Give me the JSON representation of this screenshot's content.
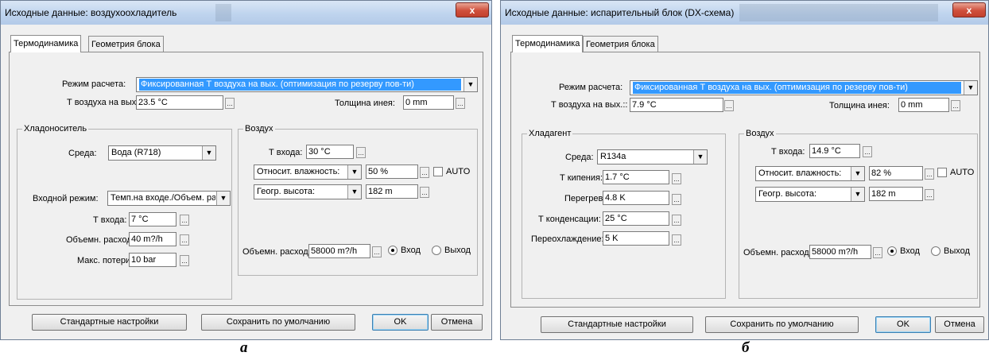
{
  "dialog_a": {
    "title": "Исходные данные: воздухоохладитель",
    "close": "x",
    "tabs": [
      "Термодинамика",
      "Геометрия блока"
    ],
    "mode_label": "Режим расчета:",
    "mode_value": "Фиксированная Т воздуха на вых. (оптимизация по резерву пов-ти)",
    "t_out_label": "Т воздуха на вых.::",
    "t_out_value": "23.5 °C",
    "frost_label": "Толщина инея:",
    "frost_value": "0 mm",
    "coolant": {
      "title": "Хладоноситель",
      "medium_label": "Среда:",
      "medium_value": "Вода (R718)",
      "inlet_mode_label": "Входной режим:",
      "inlet_mode_value": "Темп.на входе./Объем. расход",
      "t_in_label": "Т входа:",
      "t_in_value": "7 °C",
      "flow_label": "Объемн. расход:",
      "flow_value": "40 m?/h",
      "loss_label": "Макс. потери",
      "loss_value": "10 bar"
    },
    "air": {
      "title": "Воздух",
      "t_in_label": "Т входа:",
      "t_in_value": "30 °C",
      "humidity_select": "Относит. влажность:",
      "humidity_value": "50 %",
      "auto_label": "AUTO",
      "altitude_select": "Геогр. высота:",
      "altitude_value": "182 m",
      "flow_label": "Объемн. расход:",
      "flow_value": "58000 m?/h",
      "radio_in": "Вход",
      "radio_out": "Выход"
    },
    "buttons": {
      "defaults": "Стандартные настройки",
      "save_default": "Сохранить по умолчанию",
      "ok": "OK",
      "cancel": "Отмена"
    }
  },
  "dialog_b": {
    "title": "Исходные данные: испарительный блок (DX-схема)",
    "close": "x",
    "tabs": [
      "Термодинамика",
      "Геометрия блока"
    ],
    "mode_label": "Режим расчета:",
    "mode_value": "Фиксированная Т воздуха на вых. (оптимизация по резерву пов-ти)",
    "t_out_label": "Т воздуха на вых.::",
    "t_out_value": "7.9 °C",
    "frost_label": "Толщина инея:",
    "frost_value": "0 mm",
    "refrigerant": {
      "title": "Хладагент",
      "medium_label": "Среда:",
      "medium_value": "R134a",
      "t_boil_label": "Т кипения:",
      "t_boil_value": "1.7 °C",
      "superheat_label": "Перегрев:",
      "superheat_value": "4.8 K",
      "t_cond_label": "Т конденсации:",
      "t_cond_value": "25 °C",
      "subcool_label": "Переохлаждение:",
      "subcool_value": "5 K"
    },
    "air": {
      "title": "Воздух",
      "t_in_label": "Т входа:",
      "t_in_value": "14.9 °C",
      "humidity_select": "Относит. влажность:",
      "humidity_value": "82 %",
      "auto_label": "AUTO",
      "altitude_select": "Геогр. высота:",
      "altitude_value": "182 m",
      "flow_label": "Объемн. расход:",
      "flow_value": "58000 m?/h",
      "radio_in": "Вход",
      "radio_out": "Выход"
    },
    "buttons": {
      "defaults": "Стандартные настройки",
      "save_default": "Сохранить по умолчанию",
      "ok": "OK",
      "cancel": "Отмена"
    }
  },
  "captions": {
    "a": "а",
    "b": "б"
  },
  "icons": {
    "dropdown": "chevron-down-icon",
    "browse": "ellipsis-icon",
    "close": "close-icon"
  },
  "colors": {
    "selection": "#3399ff",
    "close_button": "#c9493a",
    "title_bar": "#c9dbf0"
  }
}
